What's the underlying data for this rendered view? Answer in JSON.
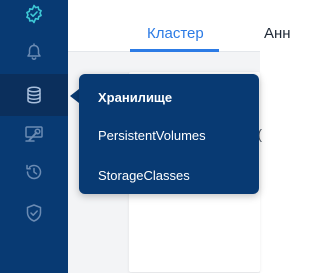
{
  "sidebar": {
    "items": [
      {
        "icon": "gear-icon",
        "active": false
      },
      {
        "icon": "bell-icon",
        "active": false
      },
      {
        "icon": "database-icon",
        "active": true
      },
      {
        "icon": "wrench-icon",
        "active": false
      },
      {
        "icon": "history-icon",
        "active": false
      },
      {
        "icon": "shield-check-icon",
        "active": false
      }
    ]
  },
  "tabs": [
    {
      "label": "Кластер",
      "active": true
    },
    {
      "label": "Анн"
    }
  ],
  "flyout": {
    "title": "Хранилище",
    "items": [
      "PersistentVolumes",
      "StorageClasses"
    ]
  },
  "card": {
    "glyph": "("
  },
  "colors": {
    "sidebar_bg": "#083a73",
    "accent": "#2c7be5",
    "gear_icon": "#3ec9d6",
    "rail_icon": "#6b8bb3"
  }
}
